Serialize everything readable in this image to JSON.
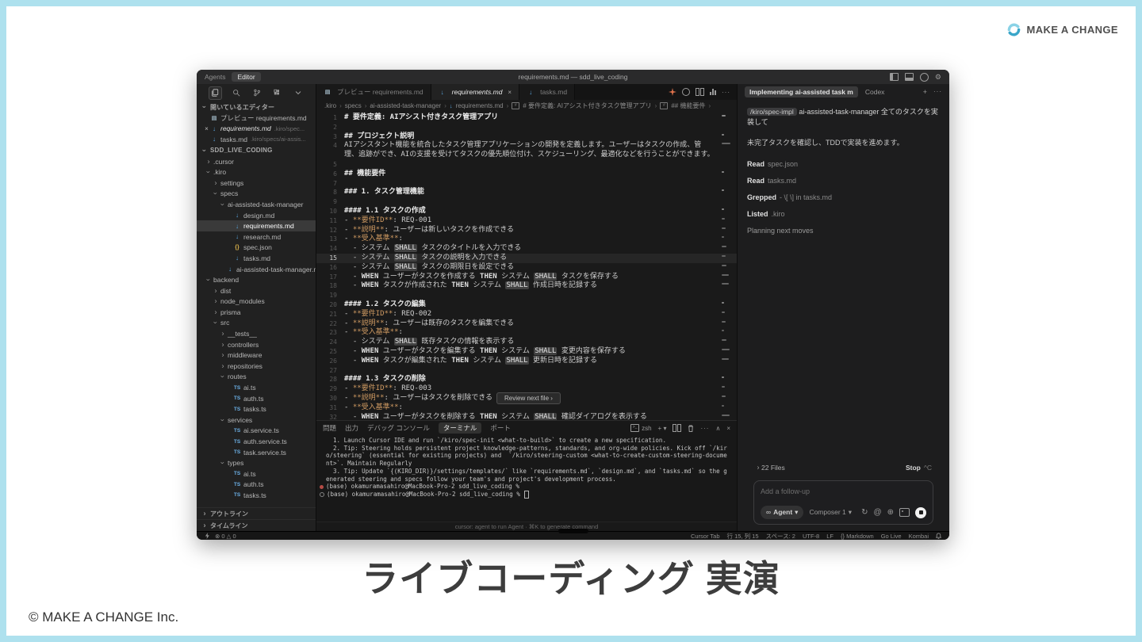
{
  "colors": {
    "slide_border": "#aee1ee",
    "brand_cyan": "#45b6d6",
    "kiro_orange": "#e0724c",
    "md_accent": "#cf9a62"
  },
  "slide": {
    "logo_text": "MAKE A CHANGE",
    "title": "ライブコーディング 実演",
    "copyright": "© MAKE A CHANGE Inc."
  },
  "titlebar": {
    "agents": "Agents",
    "editor": "Editor",
    "title": "requirements.md — sdd_live_coding"
  },
  "sidebar": {
    "open_editors_label": "開いているエディター",
    "open_editors": [
      {
        "icon": "prev",
        "label": "プレビュー requirements.md",
        "detail": "",
        "close": false
      },
      {
        "icon": "md",
        "label": "requirements.md",
        "detail": ".kiro/spec...",
        "close": true,
        "italic": true
      },
      {
        "icon": "md",
        "label": "tasks.md",
        "detail": ".kiro/specs/ai-assis...",
        "close": false
      }
    ],
    "project_label": "SDD_LIVE_CODING",
    "tree": [
      {
        "label": ".cursor",
        "kind": "folder",
        "indent": 1,
        "open": false
      },
      {
        "label": ".kiro",
        "kind": "folder",
        "indent": 1,
        "open": true
      },
      {
        "label": "settings",
        "kind": "folder",
        "indent": 2,
        "open": false
      },
      {
        "label": "specs",
        "kind": "folder",
        "indent": 2,
        "open": true
      },
      {
        "label": "ai-assisted-task-manager",
        "kind": "folder",
        "indent": 3,
        "open": true
      },
      {
        "label": "design.md",
        "kind": "md",
        "indent": 4
      },
      {
        "label": "requirements.md",
        "kind": "md",
        "indent": 4,
        "selected": true
      },
      {
        "label": "research.md",
        "kind": "md",
        "indent": 4
      },
      {
        "label": "spec.json",
        "kind": "json",
        "indent": 4
      },
      {
        "label": "tasks.md",
        "kind": "md",
        "indent": 4
      },
      {
        "label": "ai-assisted-task-manager.md",
        "kind": "md",
        "indent": 3
      },
      {
        "label": "backend",
        "kind": "folder",
        "indent": 1,
        "open": true
      },
      {
        "label": "dist",
        "kind": "folder",
        "indent": 2,
        "open": false
      },
      {
        "label": "node_modules",
        "kind": "folder",
        "indent": 2,
        "open": false
      },
      {
        "label": "prisma",
        "kind": "folder",
        "indent": 2,
        "open": false
      },
      {
        "label": "src",
        "kind": "folder",
        "indent": 2,
        "open": true
      },
      {
        "label": "__tests__",
        "kind": "folder",
        "indent": 3,
        "open": false
      },
      {
        "label": "controllers",
        "kind": "folder",
        "indent": 3,
        "open": false
      },
      {
        "label": "middleware",
        "kind": "folder",
        "indent": 3,
        "open": false
      },
      {
        "label": "repositories",
        "kind": "folder",
        "indent": 3,
        "open": false
      },
      {
        "label": "routes",
        "kind": "folder",
        "indent": 3,
        "open": true
      },
      {
        "label": "ai.ts",
        "kind": "ts",
        "indent": 4
      },
      {
        "label": "auth.ts",
        "kind": "ts",
        "indent": 4
      },
      {
        "label": "tasks.ts",
        "kind": "ts",
        "indent": 4
      },
      {
        "label": "services",
        "kind": "folder",
        "indent": 3,
        "open": true
      },
      {
        "label": "ai.service.ts",
        "kind": "ts",
        "indent": 4
      },
      {
        "label": "auth.service.ts",
        "kind": "ts",
        "indent": 4
      },
      {
        "label": "task.service.ts",
        "kind": "ts",
        "indent": 4
      },
      {
        "label": "types",
        "kind": "folder",
        "indent": 3,
        "open": true
      },
      {
        "label": "ai.ts",
        "kind": "ts",
        "indent": 4
      },
      {
        "label": "auth.ts",
        "kind": "ts",
        "indent": 4
      },
      {
        "label": "tasks.ts",
        "kind": "ts",
        "indent": 4
      }
    ],
    "outline_label": "アウトライン",
    "timeline_label": "タイムライン"
  },
  "editor": {
    "tabs": [
      {
        "icon": "prev",
        "label": "プレビュー requirements.md",
        "active": false,
        "close": false
      },
      {
        "icon": "md",
        "label": "requirements.md",
        "active": true,
        "close": true
      },
      {
        "icon": "md",
        "label": "tasks.md",
        "active": false,
        "close": false
      }
    ],
    "breadcrumb": [
      {
        "label": ".kiro"
      },
      {
        "label": "specs"
      },
      {
        "label": "ai-assisted-task-manager"
      },
      {
        "label": "requirements.md",
        "icon": "md"
      },
      {
        "label": "# 要件定義: AIアシスト付きタスク管理アプリ",
        "icon": "sym"
      },
      {
        "label": "## 機能要件",
        "icon": "sym"
      }
    ],
    "current_line": 15,
    "lines": [
      {
        "n": 1,
        "t": "# 要件定義: AIアシスト付きタスク管理アプリ"
      },
      {
        "n": 2,
        "t": ""
      },
      {
        "n": 3,
        "t": "## プロジェクト説明"
      },
      {
        "n": 4,
        "t": "AIアシスタント機能を統合したタスク管理アプリケーションの開発を定義します。ユーザーはタスクの作成、管理、追跡ができ、AIの支援を受けてタスクの優先順位付け、スケジューリング、最適化などを行うことができます。"
      },
      {
        "n": 5,
        "t": ""
      },
      {
        "n": 6,
        "t": "## 機能要件"
      },
      {
        "n": 7,
        "t": ""
      },
      {
        "n": 8,
        "t": "### 1. タスク管理機能"
      },
      {
        "n": 9,
        "t": ""
      },
      {
        "n": 10,
        "t": "#### 1.1 タスクの作成"
      },
      {
        "n": 11,
        "t": "- **要件ID**: REQ-001"
      },
      {
        "n": 12,
        "t": "- **説明**: ユーザーは新しいタスクを作成できる"
      },
      {
        "n": 13,
        "t": "- **受入基準**:"
      },
      {
        "n": 14,
        "t": "  - システム SHALL タスクのタイトルを入力できる"
      },
      {
        "n": 15,
        "t": "  - システム SHALL タスクの説明を入力できる"
      },
      {
        "n": 16,
        "t": "  - システム SHALL タスクの期限日を設定できる"
      },
      {
        "n": 17,
        "t": "  - WHEN ユーザーがタスクを作成する THEN システム SHALL タスクを保存する"
      },
      {
        "n": 18,
        "t": "  - WHEN タスクが作成された THEN システム SHALL 作成日時を記録する"
      },
      {
        "n": 19,
        "t": ""
      },
      {
        "n": 20,
        "t": "#### 1.2 タスクの編集"
      },
      {
        "n": 21,
        "t": "- **要件ID**: REQ-002"
      },
      {
        "n": 22,
        "t": "- **説明**: ユーザーは既存のタスクを編集できる"
      },
      {
        "n": 23,
        "t": "- **受入基準**:"
      },
      {
        "n": 24,
        "t": "  - システム SHALL 既存タスクの情報を表示する"
      },
      {
        "n": 25,
        "t": "  - WHEN ユーザーがタスクを編集する THEN システム SHALL 変更内容を保存する"
      },
      {
        "n": 26,
        "t": "  - WHEN タスクが編集された THEN システム SHALL 更新日時を記録する"
      },
      {
        "n": 27,
        "t": ""
      },
      {
        "n": 28,
        "t": "#### 1.3 タスクの削除"
      },
      {
        "n": 29,
        "t": "- **要件ID**: REQ-003"
      },
      {
        "n": 30,
        "t": "- **説明**: ユーザーはタスクを削除できる"
      },
      {
        "n": 31,
        "t": "- **受入基準**:"
      },
      {
        "n": 32,
        "t": "  - WHEN ユーザーがタスクを削除する THEN システム SHALL 確認ダイアログを表示する"
      }
    ],
    "review_button": "Review next file ›"
  },
  "terminal": {
    "tabs": {
      "problems": "問題",
      "output": "出力",
      "debug": "デバッグ コンソール",
      "terminal": "ターミナル",
      "ports": "ポート"
    },
    "shell": "zsh",
    "output": [
      "  1. Launch Cursor IDE and run `/kiro/spec-init <what-to-build>` to create a new specification.",
      "  2. Tip: Steering holds persistent project knowledge-patterns, standards, and org-wide policies. Kick off `/kiro/steering` (essential for existing projects) and  `/kiro/steering-custom <what-to-create-custom-steering-document>`. Maintain Regularly",
      "  3. Tip: Update `{(KIRO_DIR)}/settings/templates/` like `requirements.md`, `design.md`, and `tasks.md` so the generated steering and specs follow your team's and project's development process."
    ],
    "prompts": [
      {
        "text": "(base) okamuramasahiro@MacBook-Pro-2 sdd_live_coding %",
        "marker": "filled",
        "cursor": false
      },
      {
        "text": "(base) okamuramasahiro@MacBook-Pro-2 sdd_live_coding %",
        "marker": "hollow",
        "cursor": true
      }
    ],
    "hint": "cursor: agent to run Agent · ⌘K to generate command"
  },
  "chat": {
    "tab_active": "Implementing ai-assisted task m",
    "tab_codex": "Codex",
    "user_chip": "/kiro/spec-impl",
    "user_text": "ai-assisted-task-manager 全てのタスクを実装して",
    "assistant_text": "未完了タスクを確認し、TDDで実装を進めます。",
    "tools": [
      {
        "verb": "Read",
        "rest": "spec.json"
      },
      {
        "verb": "Read",
        "rest": "tasks.md"
      },
      {
        "verb": "Grepped",
        "rest": "- \\[ \\] in tasks.md"
      },
      {
        "verb": "Listed",
        "rest": ".kiro"
      },
      {
        "verb": "Planning next moves",
        "rest": "",
        "dim": true
      }
    ],
    "files_count": "22 Files",
    "stop_label": "Stop",
    "stop_key": "^C",
    "input_placeholder": "Add a follow-up",
    "agent_label": "Agent",
    "composer_label": "Composer 1"
  },
  "statusbar": {
    "errors": "0",
    "warnings": "0",
    "items": [
      "Cursor Tab",
      "行 15, 列 15",
      "スペース: 2",
      "UTF-8",
      "LF",
      "{} Markdown",
      "Go Live",
      "Kombai"
    ]
  }
}
